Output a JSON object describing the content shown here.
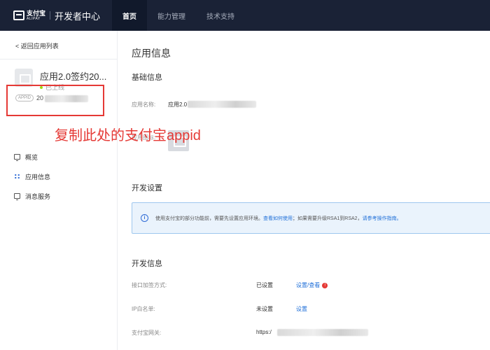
{
  "topbar": {
    "logo_cn": "支付宝",
    "logo_en": "ALIPAY",
    "title": "开发者中心",
    "nav": [
      "首页",
      "能力管理",
      "技术支持"
    ]
  },
  "sidebar": {
    "back_label": "< 返回应用列表",
    "app_name": "应用2.0签约20...",
    "app_status": "已上线",
    "appid_badge": "APPID",
    "appid_prefix": "20",
    "menu": [
      {
        "icon": "monitor-icon",
        "label": "概览"
      },
      {
        "icon": "grid-icon",
        "label": "应用信息"
      },
      {
        "icon": "message-icon",
        "label": "消息服务"
      }
    ]
  },
  "annotation": "复制此处的支付宝appid",
  "main": {
    "page_title": "应用信息",
    "basic_title": "基础信息",
    "app_name_label": "应用名称:",
    "app_name_value": "应用2.0",
    "logo_label": "应用图标:",
    "dev_settings_title": "开发设置",
    "info_prefix": "使用支付宝的部分功能前，需要先设置应用环境。",
    "info_link1": "查看如何使用",
    "info_middle": "；如果需要升级RSA1到RSA2，",
    "info_link2": "请参考操作指南。",
    "dev_info_title": "开发信息",
    "rows": [
      {
        "label": "接口加签方式:",
        "status": "已设置",
        "action": "设置/查看"
      },
      {
        "label": "IP白名单:",
        "status": "未设置",
        "action": "设置"
      },
      {
        "label": "支付宝网关:",
        "status": "https:/",
        "action": ""
      }
    ]
  },
  "colors": {
    "topbar_bg": "#1a2236",
    "accent": "#1f6fd8",
    "annotation_red": "#e53935",
    "info_bg": "#eaf3fc"
  }
}
